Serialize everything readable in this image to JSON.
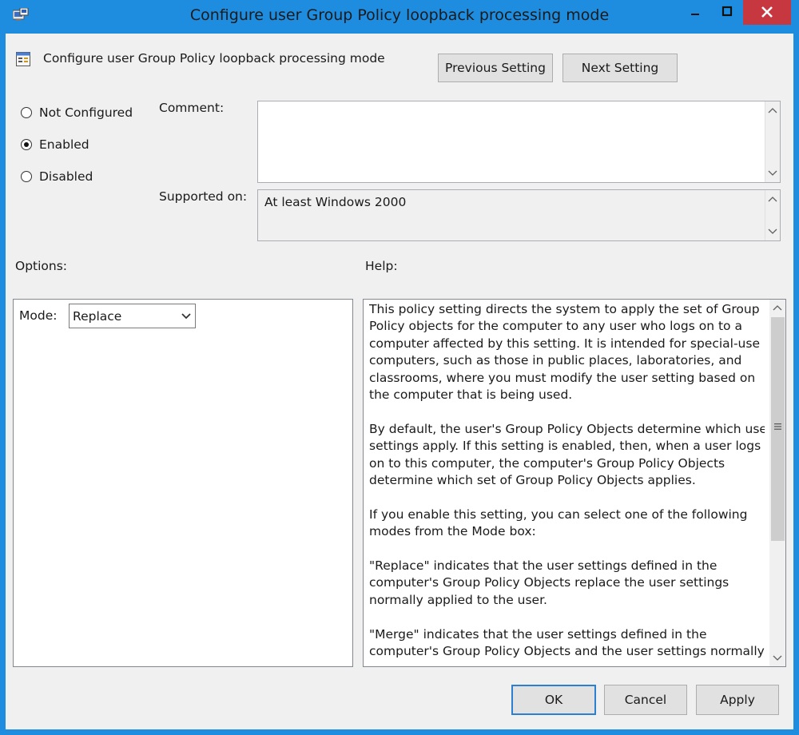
{
  "window": {
    "title": "Configure user Group Policy loopback processing mode"
  },
  "header": {
    "policy_name": "Configure user Group Policy loopback processing mode",
    "previous_label": "Previous Setting",
    "next_label": "Next Setting"
  },
  "state": {
    "options": [
      {
        "label": "Not Configured",
        "selected": false
      },
      {
        "label": "Enabled",
        "selected": true
      },
      {
        "label": "Disabled",
        "selected": false
      }
    ]
  },
  "comment": {
    "label": "Comment:",
    "value": ""
  },
  "supported": {
    "label": "Supported on:",
    "value": "At least Windows 2000"
  },
  "options_panel": {
    "label": "Options:",
    "mode_label": "Mode:",
    "mode_value": "Replace"
  },
  "help_panel": {
    "label": "Help:",
    "lines": [
      "This policy setting directs the system to apply the set of Group",
      "Policy objects for the computer to any user who logs on to a",
      "computer affected by this setting. It is intended for special-use",
      "computers, such as those in public places, laboratories, and",
      "classrooms, where you must modify the user setting based on",
      "the computer that is being used.",
      "",
      "By default, the user's Group Policy Objects determine which user",
      "settings apply. If this setting is enabled, then, when a user logs",
      "on to this computer, the computer's Group Policy Objects",
      "determine which set of Group Policy Objects applies.",
      "",
      "If you enable this setting, you can select one of the following",
      "modes from the Mode box:",
      "",
      "\"Replace\" indicates that the user settings defined in the",
      "computer's Group Policy Objects replace the user settings",
      "normally applied to the user.",
      "",
      "\"Merge\" indicates that the user settings defined in the",
      "computer's Group Policy Objects and the user settings normally"
    ]
  },
  "footer": {
    "ok_label": "OK",
    "cancel_label": "Cancel",
    "apply_label": "Apply"
  }
}
